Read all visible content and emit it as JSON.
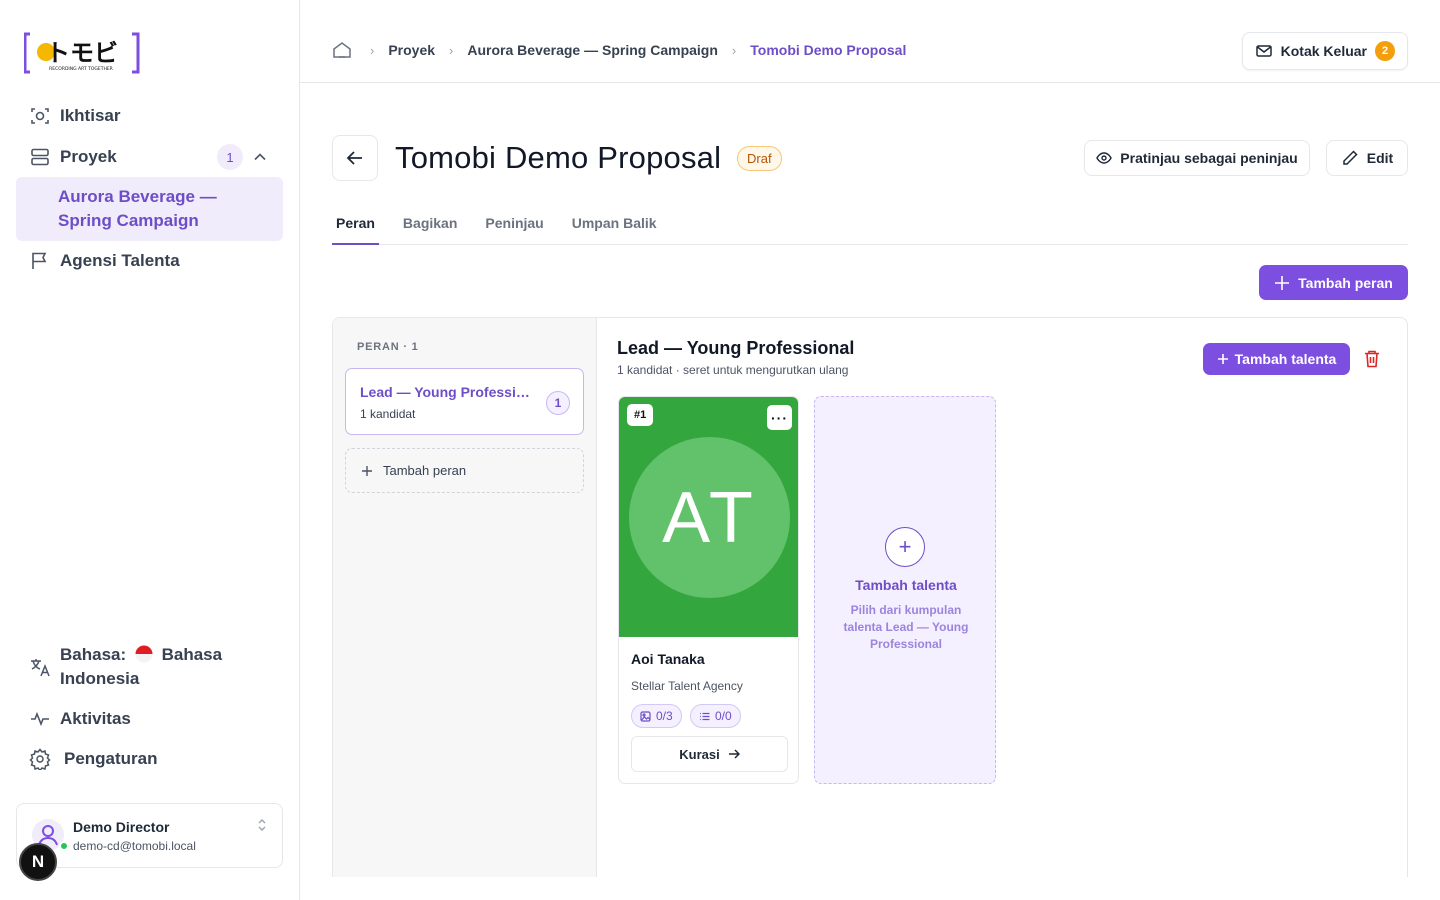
{
  "logo": {
    "text": "トモビ",
    "tagline": "RECORDING ART TOGETHER"
  },
  "sidebar": {
    "items": [
      {
        "label": "Ikhtisar",
        "icon": "overview-icon"
      },
      {
        "label": "Proyek",
        "icon": "projects-icon",
        "count": "1"
      },
      {
        "label": "Agensi Talenta",
        "icon": "flag-icon"
      }
    ],
    "active_project": "Aurora Beverage — Spring Campaign",
    "language": {
      "prefix": "Bahasa:",
      "value": "Bahasa Indonesia"
    },
    "activity": "Aktivitas",
    "settings": "Pengaturan",
    "user": {
      "name": "Demo Director",
      "email": "demo-cd@tomobi.local"
    },
    "next_badge": "N"
  },
  "header": {
    "breadcrumbs": [
      "Proyek",
      "Aurora Beverage — Spring Campaign",
      "Tomobi Demo Proposal"
    ],
    "outbox": {
      "label": "Kotak Keluar",
      "count": "2"
    }
  },
  "page": {
    "title": "Tomobi Demo Proposal",
    "status": "Draf",
    "preview_label": "Pratinjau sebagai peninjau",
    "edit_label": "Edit",
    "tabs": [
      "Peran",
      "Bagikan",
      "Peninjau",
      "Umpan Balik"
    ],
    "add_role_label": "Tambah peran"
  },
  "roles_panel": {
    "header": "PERAN · 1",
    "roles": [
      {
        "name": "Lead — Young Professional",
        "sub": "1 kandidat",
        "count": "1"
      }
    ],
    "add_role_label": "Tambah peran"
  },
  "role_detail": {
    "title": "Lead — Young Professional",
    "subtitle": "1 kandidat · seret untuk mengurutkan ulang",
    "add_talent_label": "Tambah talenta",
    "talents": [
      {
        "rank": "#1",
        "initials": "AT",
        "name": "Aoi Tanaka",
        "agency": "Stellar Talent Agency",
        "photos": "0/3",
        "items": "0/0",
        "curate_label": "Kurasi",
        "photo_color": "#33a63e"
      }
    ],
    "add_card": {
      "title": "Tambah talenta",
      "description": "Pilih dari kumpulan talenta Lead — Young Professional"
    }
  },
  "colors": {
    "accent": "#7c4fe0",
    "accent_text": "#6d4ec6",
    "draft": "#b45309",
    "outbox_badge": "#f59e0b"
  }
}
